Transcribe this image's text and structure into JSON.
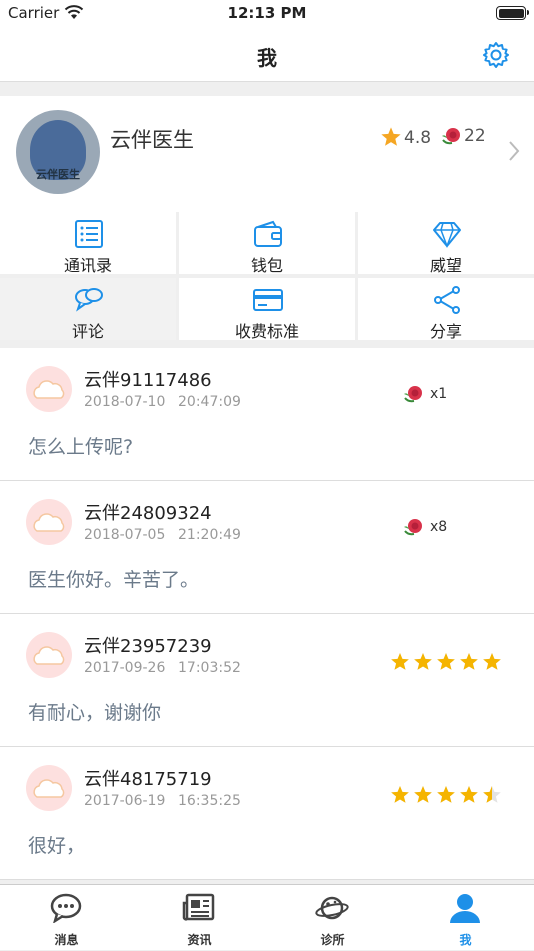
{
  "status_bar": {
    "carrier": "Carrier",
    "time": "12:13 PM"
  },
  "nav": {
    "title": "我",
    "settings_icon": "gear-icon"
  },
  "profile": {
    "avatar_text": "云伴医生",
    "name": "云伴医生",
    "rating": "4.8",
    "flowers": "22"
  },
  "menu": [
    {
      "label": "通讯录",
      "icon": "contacts-icon"
    },
    {
      "label": "钱包",
      "icon": "wallet-icon"
    },
    {
      "label": "威望",
      "icon": "diamond-icon"
    },
    {
      "label": "评论",
      "icon": "comments-icon"
    },
    {
      "label": "收费标准",
      "icon": "card-icon"
    },
    {
      "label": "分享",
      "icon": "share-icon"
    }
  ],
  "reviews": [
    {
      "user": "云伴91117486",
      "date": "2018-07-10",
      "time": "20:47:09",
      "gift": "x1",
      "stars": null,
      "text": "怎么上传呢?"
    },
    {
      "user": "云伴24809324",
      "date": "2018-07-05",
      "time": "21:20:49",
      "gift": "x8",
      "stars": null,
      "text": "医生你好。辛苦了。"
    },
    {
      "user": "云伴23957239",
      "date": "2017-09-26",
      "time": "17:03:52",
      "gift": null,
      "stars": 5,
      "text": "有耐心，谢谢你"
    },
    {
      "user": "云伴48175719",
      "date": "2017-06-19",
      "time": "16:35:25",
      "gift": null,
      "stars": 4.5,
      "text": "很好，"
    }
  ],
  "tabs": [
    {
      "label": "消息",
      "icon": "chat-icon"
    },
    {
      "label": "资讯",
      "icon": "news-icon"
    },
    {
      "label": "诊所",
      "icon": "planet-icon"
    },
    {
      "label": "我",
      "icon": "person-icon"
    }
  ],
  "colors": {
    "accent": "#1e90e8",
    "star": "#f5b400",
    "flower": "#d8324a"
  }
}
